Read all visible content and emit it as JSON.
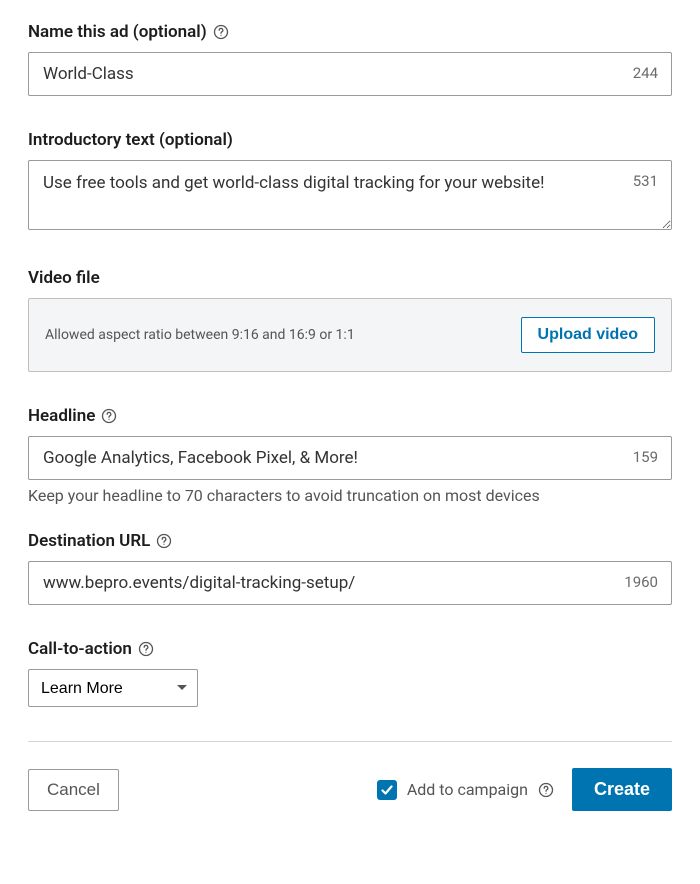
{
  "name_section": {
    "label": "Name this ad (optional)",
    "value": "World-Class",
    "counter": "244"
  },
  "intro_section": {
    "label": "Introductory text (optional)",
    "value": "Use free tools and get world-class digital tracking for your website!",
    "counter": "531"
  },
  "video_section": {
    "label": "Video file",
    "hint": "Allowed aspect ratio between 9:16 and 16:9 or 1:1",
    "button": "Upload video"
  },
  "headline_section": {
    "label": "Headline",
    "value": "Google Analytics, Facebook Pixel, & More!",
    "counter": "159",
    "hint": "Keep your headline to 70 characters to avoid truncation on most devices"
  },
  "url_section": {
    "label": "Destination URL",
    "value": "www.bepro.events/digital-tracking-setup/",
    "counter": "1960"
  },
  "cta_section": {
    "label": "Call-to-action",
    "selected": "Learn More"
  },
  "footer": {
    "cancel": "Cancel",
    "add_to_campaign": "Add to campaign",
    "create": "Create"
  }
}
